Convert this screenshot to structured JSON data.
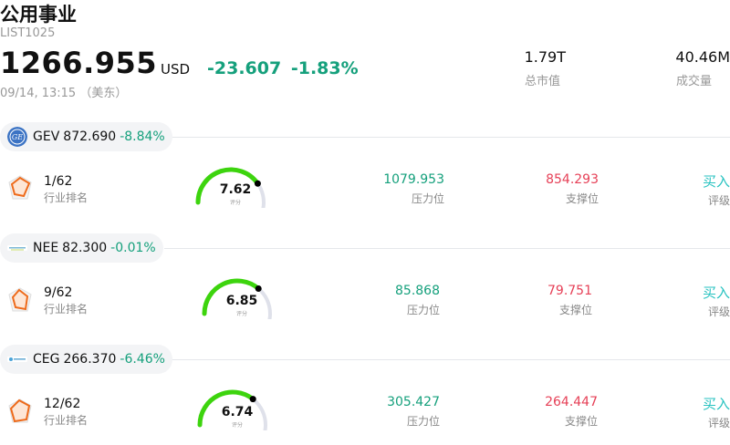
{
  "header": {
    "title": "公用事业",
    "code": "LIST1025",
    "price": "1266.955",
    "currency": "USD",
    "change": "-23.607",
    "change_pct": "-1.83%",
    "time": "09/14, 13:15 （美东）",
    "market_cap_value": "1.79T",
    "market_cap_label": "总市值",
    "volume_value": "40.46M",
    "volume_label": "成交量"
  },
  "stocks": [
    {
      "symbol": "GEV",
      "price": "872.690",
      "change_pct": "-8.84%",
      "rank": "1/62",
      "rank_label": "行业排名",
      "score": "7.62",
      "score_label": "评分",
      "resistance": "1079.953",
      "resistance_label": "压力位",
      "support": "854.293",
      "support_label": "支撑位",
      "rating": "买入",
      "rating_label": "评级"
    },
    {
      "symbol": "NEE",
      "price": "82.300",
      "change_pct": "-0.01%",
      "rank": "9/62",
      "rank_label": "行业排名",
      "score": "6.85",
      "score_label": "评分",
      "resistance": "85.868",
      "resistance_label": "压力位",
      "support": "79.751",
      "support_label": "支撑位",
      "rating": "买入",
      "rating_label": "评级"
    },
    {
      "symbol": "CEG",
      "price": "266.370",
      "change_pct": "-6.46%",
      "rank": "12/62",
      "rank_label": "行业排名",
      "score": "6.74",
      "score_label": "评分",
      "resistance": "305.427",
      "resistance_label": "压力位",
      "support": "264.447",
      "support_label": "支撑位",
      "rating": "买入",
      "rating_label": "评级"
    }
  ],
  "colors": {
    "negative": "#15a07c",
    "support": "#e64057",
    "rating": "#27c2c0",
    "gauge_fill": "#3dd40e",
    "gauge_track": "#dfe1ea"
  }
}
